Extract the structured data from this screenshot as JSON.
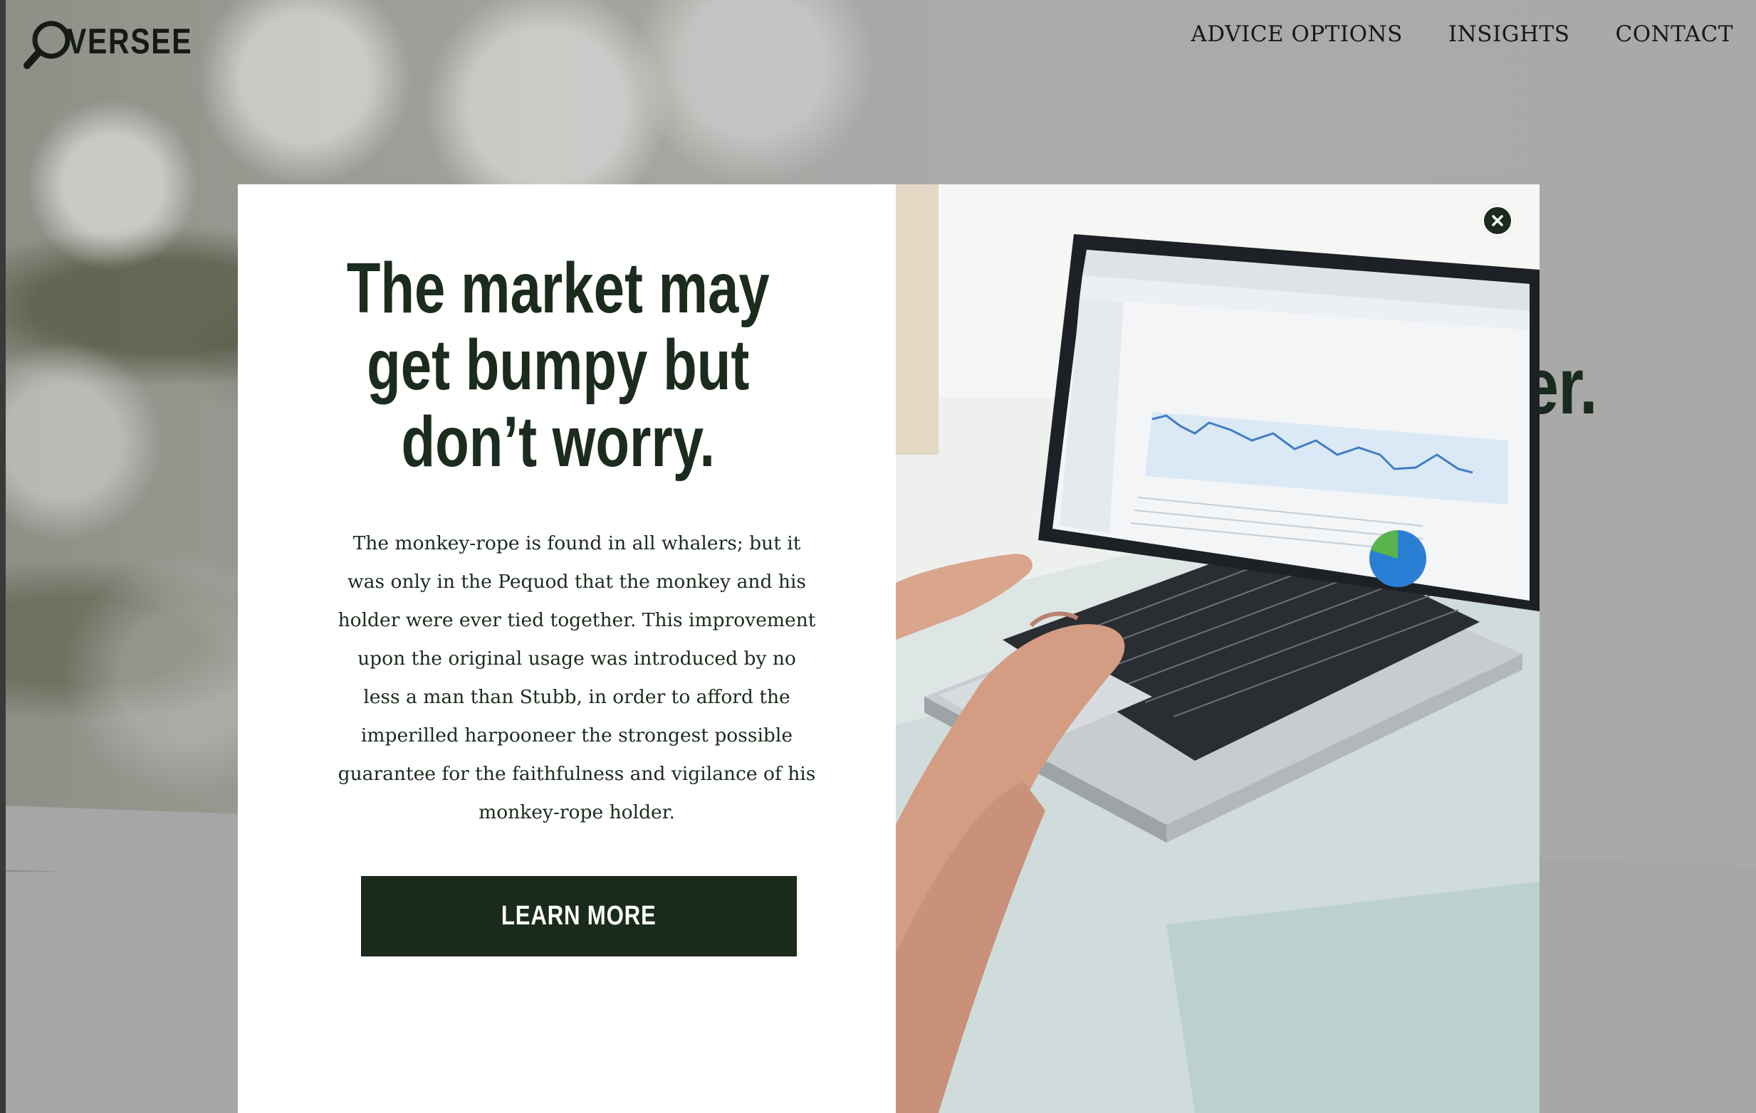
{
  "brand": {
    "logo_text": "VERSEE",
    "logo_icon": "magnifier-o-icon"
  },
  "nav": {
    "items": [
      {
        "label": "ADVICE OPTIONS"
      },
      {
        "label": "INSIGHTS"
      },
      {
        "label": "CONTACT"
      }
    ]
  },
  "background": {
    "heading_fragment": "er."
  },
  "modal": {
    "title": "The market may\nget bumpy but\ndon’t worry.",
    "body": "The monkey-rope is found in all whalers; but it was only in the Pequod that the monkey and his holder were ever tied together. This improvement upon the original usage was introduced by no less a man than Stubb, in order to afford the imperilled harpooneer the strongest possible guarantee for the faithfulness and vigilance of his monkey-rope holder.",
    "cta_label": "LEARN MORE",
    "close_icon": "close-icon",
    "image_icon": "laptop-analytics-photo",
    "colors": {
      "accent": "#1b2b1d",
      "overlay": "#a6a6a6",
      "pie_green": "#58b44a",
      "pie_blue": "#2a7fd4"
    }
  }
}
